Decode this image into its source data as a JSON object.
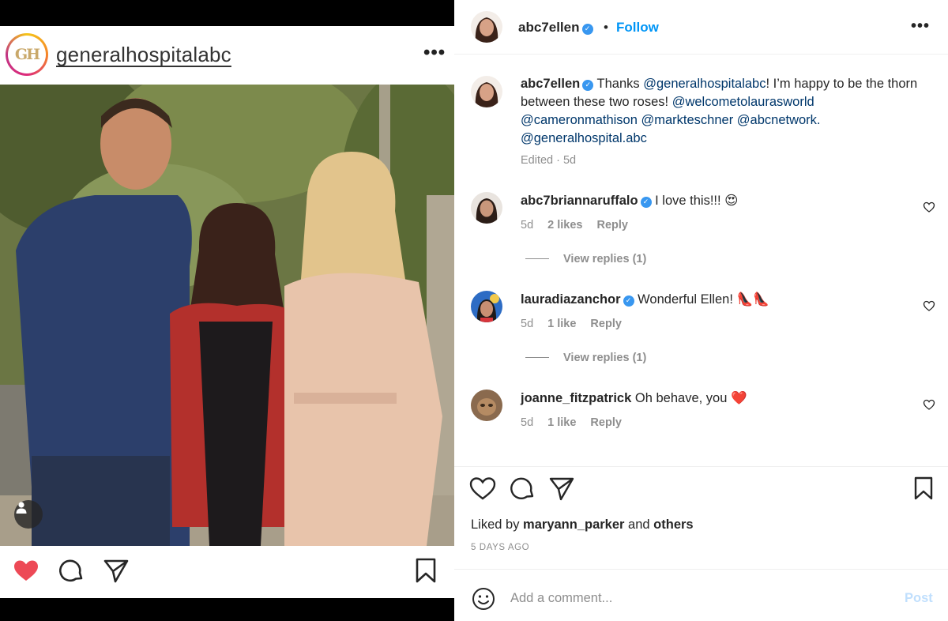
{
  "embedded_post": {
    "avatar_text": "GH",
    "username": "generalhospitalabc",
    "more": "•••",
    "liked": true
  },
  "post": {
    "author": "abc7ellen",
    "verified": true,
    "dot": "•",
    "follow_label": "Follow",
    "more": "•••",
    "caption": {
      "text_1": "Thanks ",
      "mention_1": "@generalhospitalabc",
      "text_2": "! I’m happy to be the thorn between these two roses! ",
      "mention_2": "@welcometolaurasworld",
      "mention_3": "@cameronmathison",
      "mention_4": "@markteschner",
      "mention_5": "@abcnetwork.",
      "mention_6": "@generalhospital.abc",
      "edited": "Edited",
      "sep": "·",
      "age": "5d"
    },
    "comments": [
      {
        "user": "abc7briannaruffalo",
        "verified": true,
        "text": "I love this!!! 😍",
        "age": "5d",
        "likes": "2 likes",
        "reply": "Reply",
        "view_replies": "View replies (1)"
      },
      {
        "user": "lauradiazanchor",
        "verified": true,
        "text": "Wonderful Ellen! 👠👠",
        "age": "5d",
        "likes": "1 like",
        "reply": "Reply",
        "view_replies": "View replies (1)"
      },
      {
        "user": "joanne_fitzpatrick",
        "verified": false,
        "text": "Oh behave, you ❤️",
        "age": "5d",
        "likes": "1 like",
        "reply": "Reply"
      }
    ],
    "liked_by": {
      "prefix": "Liked by ",
      "user": "maryann_parker",
      "middle": " and ",
      "others": "others"
    },
    "time_ago": "5 DAYS AGO",
    "add_comment_placeholder": "Add a comment...",
    "post_label": "Post"
  },
  "colors": {
    "accent": "#0095f6",
    "like_red": "#ed4956",
    "verified": "#3897f0",
    "muted": "#8e8e8e"
  },
  "icons": [
    "heart-icon",
    "comment-icon",
    "share-icon",
    "bookmark-icon",
    "emoji-icon",
    "user-tag-icon",
    "verified-badge-icon"
  ]
}
